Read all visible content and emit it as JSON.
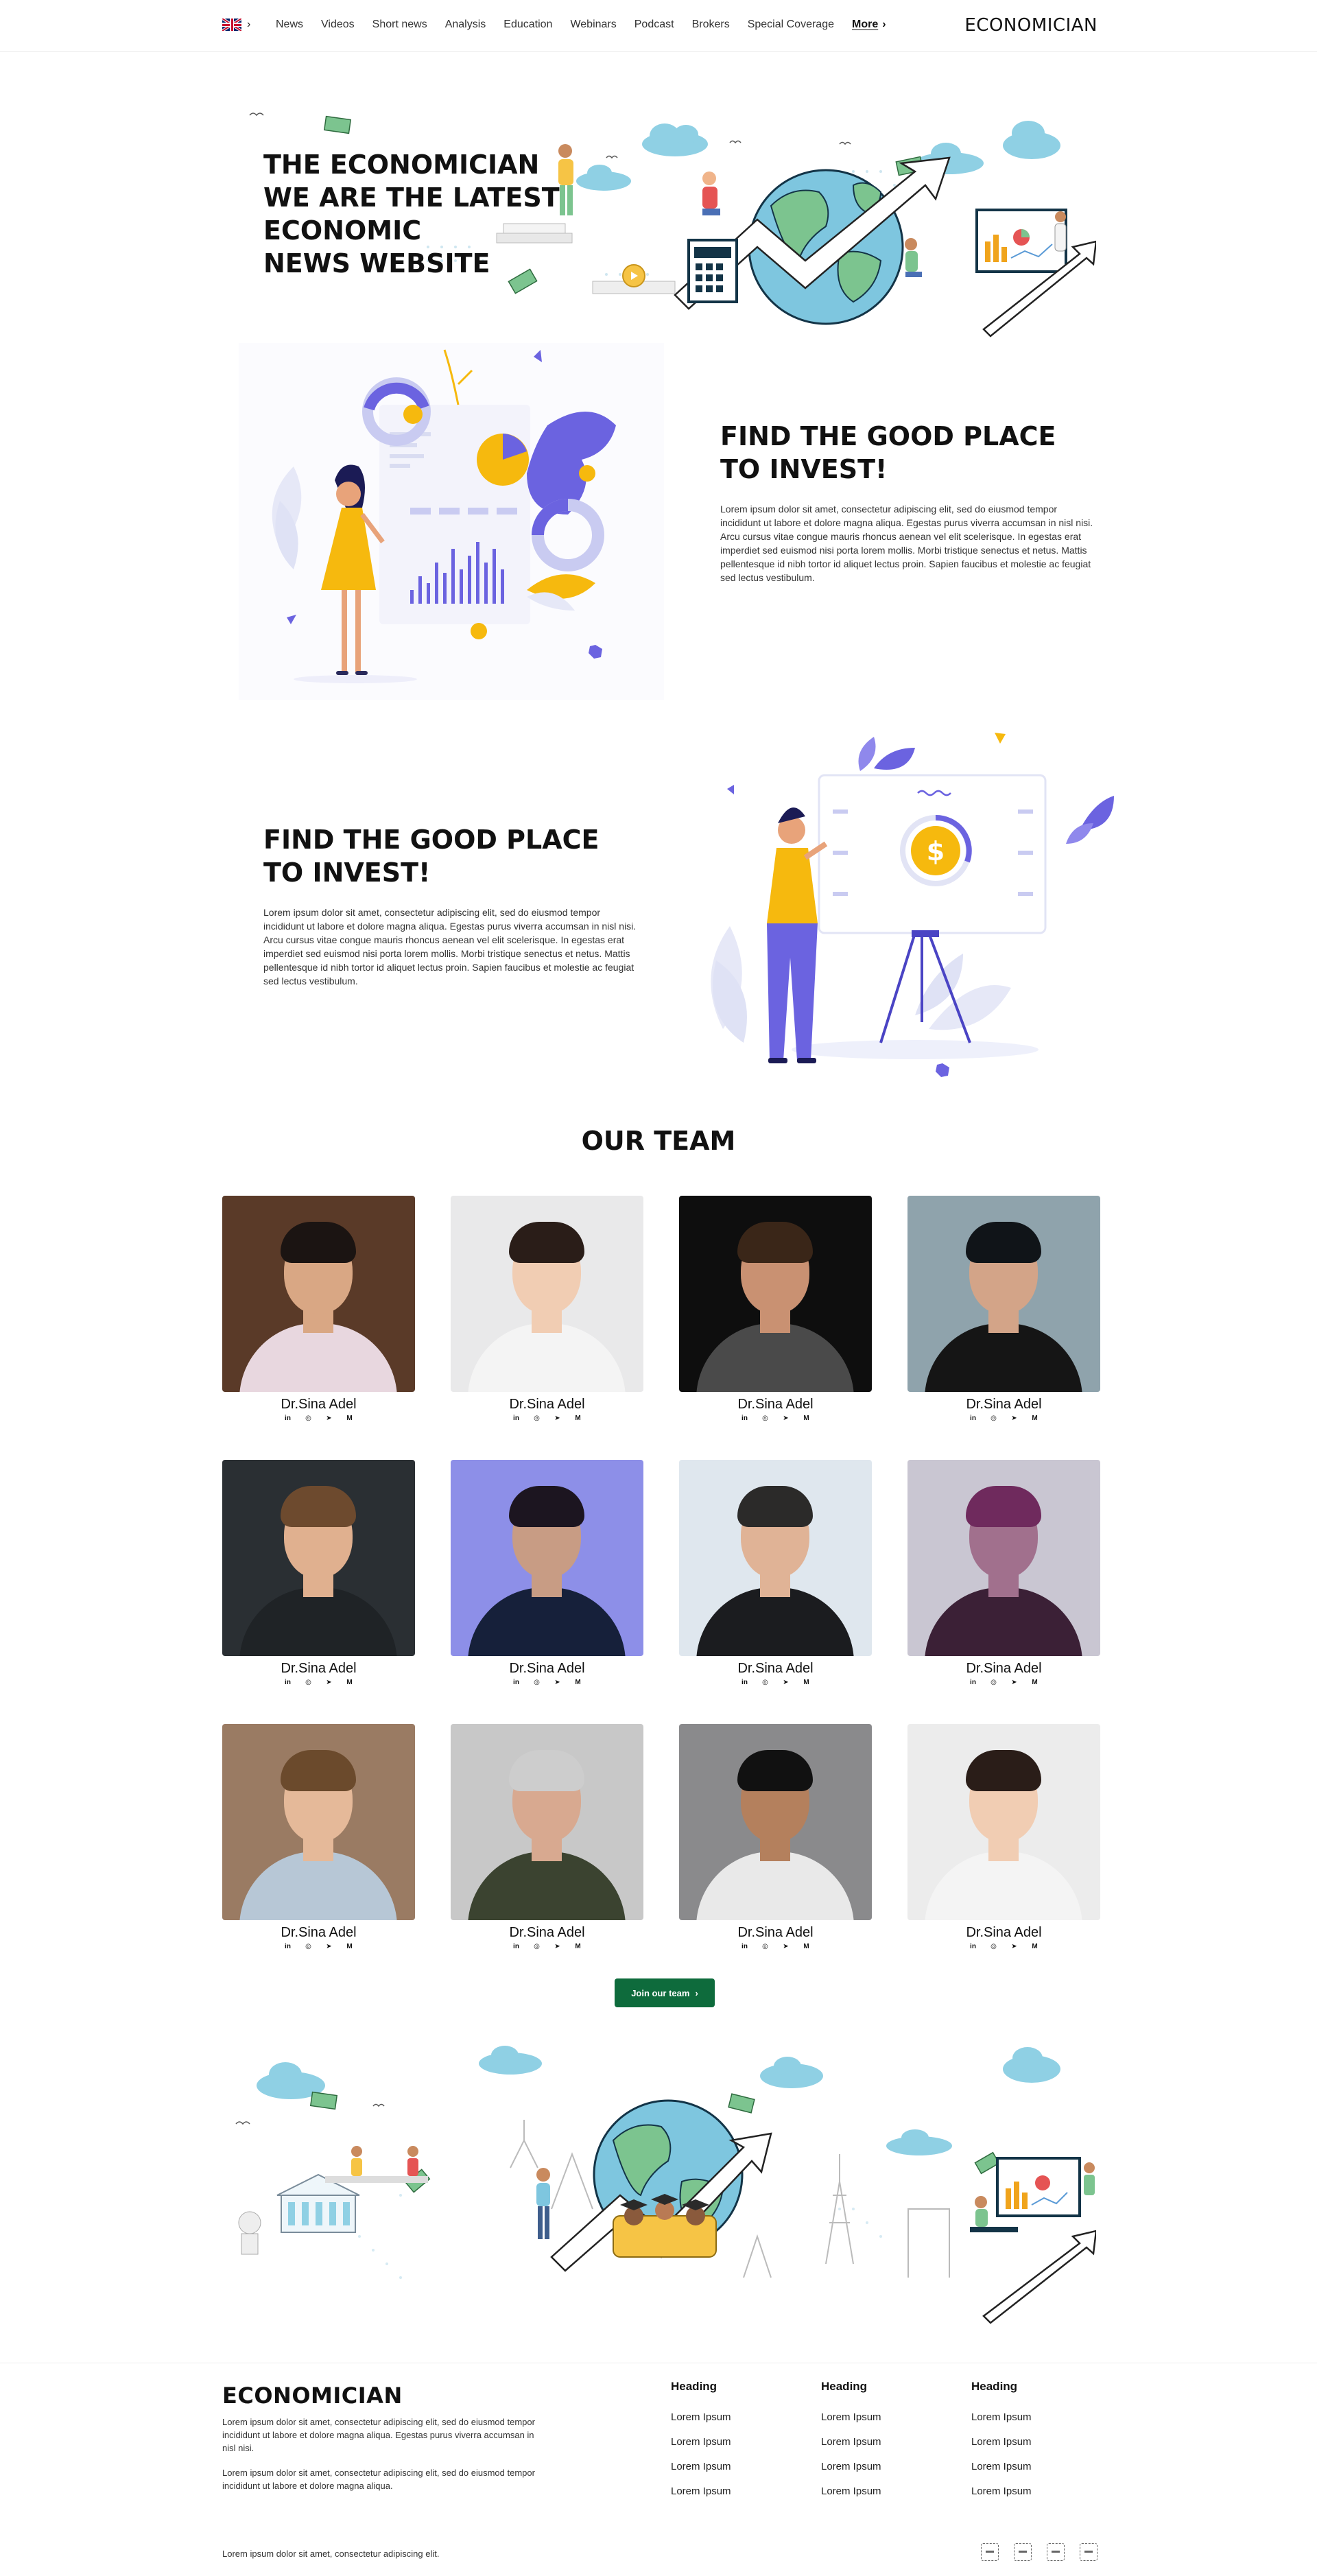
{
  "header": {
    "language": "English",
    "nav": [
      "News",
      "Videos",
      "Short news",
      "Analysis",
      "Education",
      "Webinars",
      "Podcast",
      "Brokers",
      "Special Coverage"
    ],
    "more_label": "More",
    "brand": "ECONOMICIAN"
  },
  "hero": {
    "title_lines": [
      "THE ECONOMICIAN",
      "WE ARE THE LATEST",
      "ECONOMIC",
      "NEWS WEBSITE"
    ]
  },
  "features": [
    {
      "title_lines": [
        "FIND THE GOOD PLACE",
        "TO INVEST!"
      ],
      "text": "Lorem ipsum dolor sit amet, consectetur adipiscing elit, sed do eiusmod tempor incididunt ut labore et dolore magna aliqua. Egestas purus viverra accumsan in nisl nisi. Arcu cursus vitae congue mauris rhoncus aenean vel elit scelerisque. In egestas erat imperdiet sed euismod nisi porta lorem mollis. Morbi tristique senectus et netus. Mattis pellentesque id nibh tortor id aliquet lectus proin. Sapien faucibus et molestie ac feugiat sed lectus vestibulum."
    },
    {
      "title_lines": [
        "FIND THE GOOD PLACE",
        "TO INVEST!"
      ],
      "text": "Lorem ipsum dolor sit amet, consectetur adipiscing elit, sed do eiusmod tempor incididunt ut labore et dolore magna aliqua. Egestas purus viverra accumsan in nisl nisi. Arcu cursus vitae congue mauris rhoncus aenean vel elit scelerisque. In egestas erat imperdiet sed euismod nisi porta lorem mollis. Morbi tristique senectus et netus. Mattis pellentesque id nibh tortor id aliquet lectus proin. Sapien faucibus et molestie ac feugiat sed lectus vestibulum."
    }
  ],
  "team": {
    "title": "OUR TEAM",
    "members": [
      {
        "name": "Dr.Sina Adel",
        "bg": "#5a3a28",
        "skin": "#d9a784",
        "hair": "#1b1412",
        "shirt": "#e8d7df"
      },
      {
        "name": "Dr.Sina Adel",
        "bg": "#e9e9ea",
        "skin": "#f1cdb3",
        "hair": "#2a1d18",
        "shirt": "#f4f4f4"
      },
      {
        "name": "Dr.Sina Adel",
        "bg": "#0e0e0e",
        "skin": "#c99172",
        "hair": "#3a2618",
        "shirt": "#4a4a4a"
      },
      {
        "name": "Dr.Sina Adel",
        "bg": "#8fa3ac",
        "skin": "#d3a488",
        "hair": "#101418",
        "shirt": "#151515"
      },
      {
        "name": "Dr.Sina Adel",
        "bg": "#2a2f33",
        "skin": "#e0b08f",
        "hair": "#6d4a2e",
        "shirt": "#1f2326"
      },
      {
        "name": "Dr.Sina Adel",
        "bg": "#8d8fe8",
        "skin": "#c89c84",
        "hair": "#1c1520",
        "shirt": "#16203a"
      },
      {
        "name": "Dr.Sina Adel",
        "bg": "#dfe7ee",
        "skin": "#e0b396",
        "hair": "#2b2a29",
        "shirt": "#1b1c1f"
      },
      {
        "name": "Dr.Sina Adel",
        "bg": "#c9c6d2",
        "skin": "#a1708d",
        "hair": "#6f2a5d",
        "shirt": "#3b2036"
      },
      {
        "name": "Dr.Sina Adel",
        "bg": "#9a7b63",
        "skin": "#e5b999",
        "hair": "#6b4a2c",
        "shirt": "#b7c7d6"
      },
      {
        "name": "Dr.Sina Adel",
        "bg": "#c8c8c8",
        "skin": "#d8a990",
        "hair": "#cdcdcd",
        "shirt": "#3b4330"
      },
      {
        "name": "Dr.Sina Adel",
        "bg": "#8a8a8c",
        "skin": "#b4805d",
        "hair": "#111111",
        "shirt": "#e9e9e9"
      },
      {
        "name": "Dr.Sina Adel",
        "bg": "#ececec",
        "skin": "#f1cdb3",
        "hair": "#2a1d18",
        "shirt": "#f4f4f4"
      }
    ],
    "join_label": "Join our team"
  },
  "footer": {
    "brand": "ECONOMICIAN",
    "text1": "Lorem ipsum dolor sit amet, consectetur adipiscing elit, sed do eiusmod tempor incididunt ut labore et dolore magna aliqua. Egestas purus viverra accumsan in nisl nisi.",
    "text2": "Lorem ipsum dolor sit amet, consectetur adipiscing elit, sed do eiusmod tempor incididunt ut labore et dolore magna aliqua.",
    "columns": [
      {
        "heading": "Heading",
        "links": [
          "Lorem Ipsum",
          "Lorem Ipsum",
          "Lorem Ipsum",
          "Lorem Ipsum"
        ]
      },
      {
        "heading": "Heading",
        "links": [
          "Lorem Ipsum",
          "Lorem Ipsum",
          "Lorem Ipsum",
          "Lorem Ipsum"
        ]
      },
      {
        "heading": "Heading",
        "links": [
          "Lorem Ipsum",
          "Lorem Ipsum",
          "Lorem Ipsum",
          "Lorem Ipsum"
        ]
      }
    ],
    "copyright": "Lorem ipsum dolor sit amet, consectetur adipiscing elit."
  },
  "colors": {
    "accent_green": "#0e6b3c",
    "illus_purple": "#6b63e0",
    "illus_yellow": "#f6b90e",
    "illus_blue": "#7ec6df",
    "illus_green": "#7cc48f"
  }
}
